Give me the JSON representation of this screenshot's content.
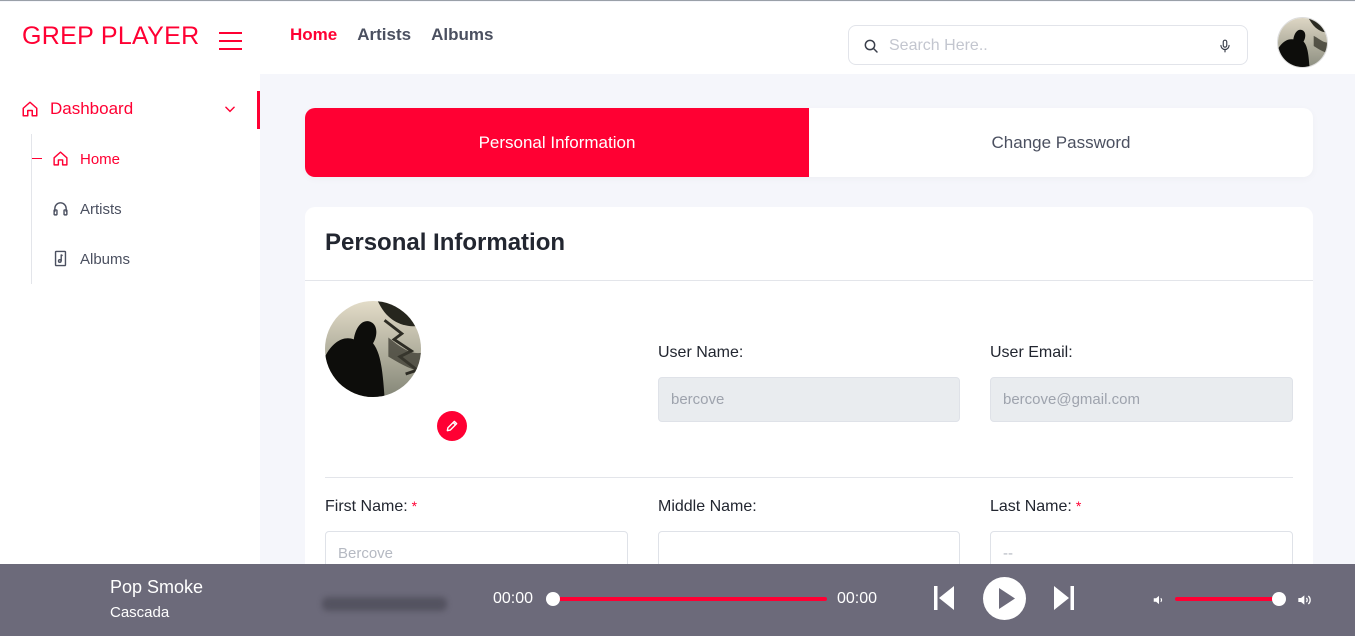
{
  "brand": "GREP PLAYER",
  "sidebar": {
    "section_label": "Dashboard",
    "items": [
      {
        "label": "Home",
        "icon": "home-icon",
        "active": true
      },
      {
        "label": "Artists",
        "icon": "headphones-icon",
        "active": false
      },
      {
        "label": "Albums",
        "icon": "music-file-icon",
        "active": false
      }
    ]
  },
  "header": {
    "nav": [
      {
        "label": "Home",
        "active": true
      },
      {
        "label": "Artists",
        "active": false
      },
      {
        "label": "Albums",
        "active": false
      }
    ],
    "search_placeholder": "Search Here.."
  },
  "tabs": {
    "personal": "Personal Information",
    "password": "Change Password"
  },
  "card": {
    "title": "Personal Information",
    "user_name_label": "User Name:",
    "user_name_value": "bercove",
    "user_email_label": "User Email:",
    "user_email_value": "bercove@gmail.com",
    "first_name_label": "First Name:",
    "first_name_placeholder": "Bercove",
    "middle_name_label": "Middle Name:",
    "middle_name_value": "",
    "last_name_label": "Last Name:",
    "last_name_placeholder": "--",
    "required_marker": "*"
  },
  "player": {
    "track_title": "Pop Smoke",
    "track_artist": "Cascada",
    "time_current": "00:00",
    "time_total": "00:00",
    "progress": 0,
    "volume": 1.0
  },
  "colors": {
    "accent": "#ff0033",
    "player_bg": "#6c6a7a",
    "page_bg": "#f5f6fb"
  }
}
